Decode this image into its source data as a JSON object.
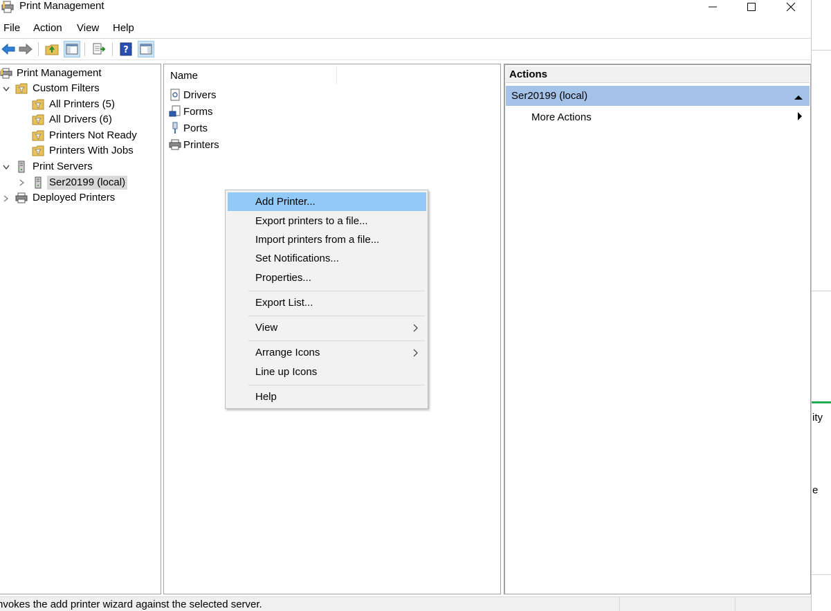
{
  "window": {
    "title": "Print Management",
    "minimize_glyph": "—",
    "maximize_glyph": "☐",
    "close_glyph": "✕"
  },
  "menubar": [
    "File",
    "Action",
    "View",
    "Help"
  ],
  "toolbar": {
    "icons": [
      "back-arrow-icon",
      "forward-arrow-icon",
      "up-folder-icon",
      "show-hide-console-tree-icon",
      "export-list-icon",
      "help-icon",
      "show-hide-action-pane-icon"
    ]
  },
  "tree": {
    "root": "Print Management",
    "custom_filters": "Custom Filters",
    "filters": [
      "All Printers (5)",
      "All Drivers (6)",
      "Printers Not Ready",
      "Printers With Jobs"
    ],
    "print_servers": "Print Servers",
    "server": "Ser20199 (local)",
    "deployed_printers": "Deployed Printers"
  },
  "list": {
    "column_name": "Name",
    "items": [
      "Drivers",
      "Forms",
      "Ports",
      "Printers"
    ]
  },
  "context_menu": {
    "items": [
      "Add Printer...",
      "Export printers to a file...",
      "Import printers from a file...",
      "Set Notifications...",
      "Properties...",
      "Export List...",
      "View",
      "Arrange Icons",
      "Line up Icons",
      "Help"
    ],
    "highlighted": "Add Printer..."
  },
  "actions": {
    "header": "Actions",
    "server": "Ser20199 (local)",
    "more_actions": "More Actions"
  },
  "status": "nvokes the add printer wizard against the selected server.",
  "background_window": {
    "fragment1": "ity",
    "fragment2": "e"
  },
  "colors": {
    "menu_highlight": "#91c9f7",
    "actions_selected": "#a5c3e8",
    "tree_selected": "#d9d9d9",
    "folder_yellow": "#e8c15a"
  }
}
